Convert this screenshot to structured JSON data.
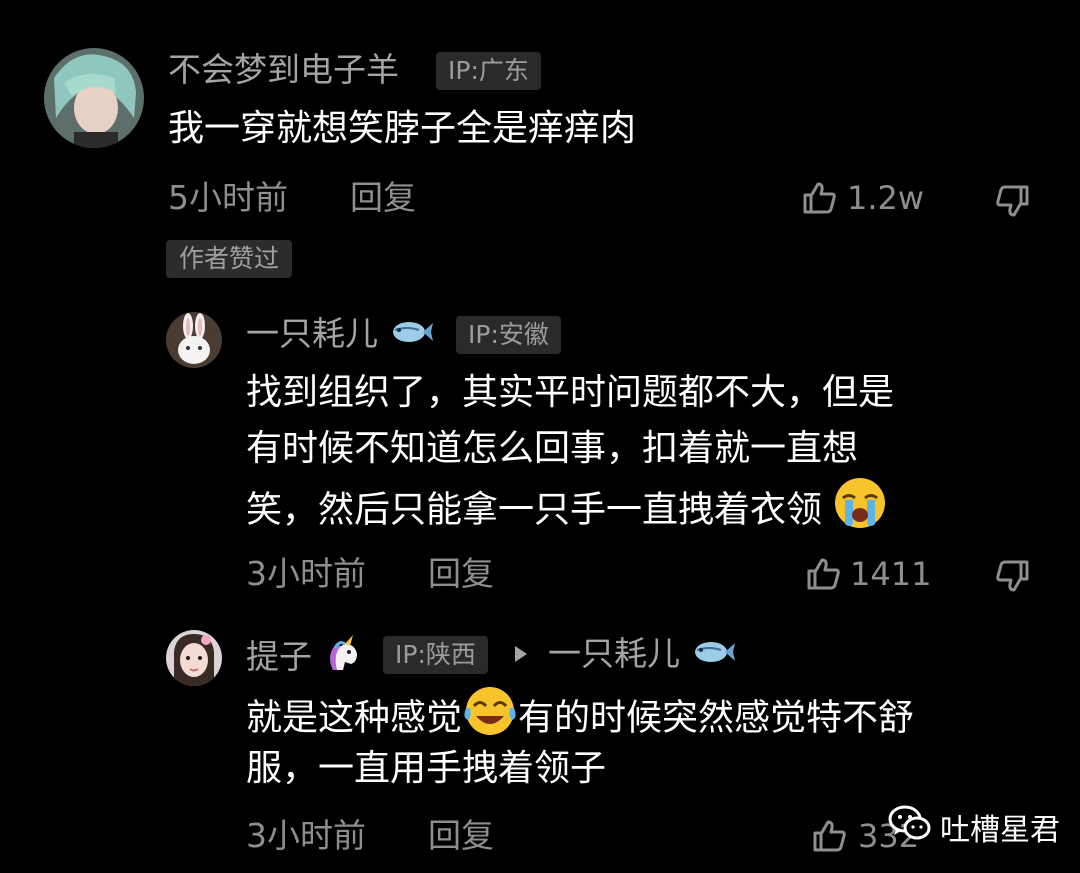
{
  "comments": [
    {
      "username": "不会梦到电子羊",
      "ip": "IP:广东",
      "text": "我一穿就想笑脖子全是痒痒肉",
      "time": "5小时前",
      "reply_label": "回复",
      "likes": "1.2w",
      "badge": "作者赞过"
    },
    {
      "username": "一只耗儿",
      "ip": "IP:安徽",
      "text_line1": "找到组织了，其实平时问题都不大，但是",
      "text_line2": "有时候不知道怎么回事，扣着就一直想",
      "text_line3": "笑，然后只能拿一只手一直拽着衣领",
      "time": "3小时前",
      "reply_label": "回复",
      "likes": "1411"
    },
    {
      "username": "提子",
      "ip": "IP:陕西",
      "reply_to": "一只耗儿",
      "text_line1a": "就是这种感觉",
      "text_line1b": "有的时候突然感觉特不舒",
      "text_line2": "服，一直用手拽着领子",
      "time": "3小时前",
      "reply_label": "回复",
      "likes": "332"
    }
  ],
  "watermark": {
    "text": "吐槽星君"
  },
  "icons": [
    "thumbs-up-icon",
    "thumbs-down-icon",
    "fish-emoji",
    "unicorn-emoji",
    "crying-emoji",
    "reply-arrow-icon",
    "wechat-icon"
  ]
}
